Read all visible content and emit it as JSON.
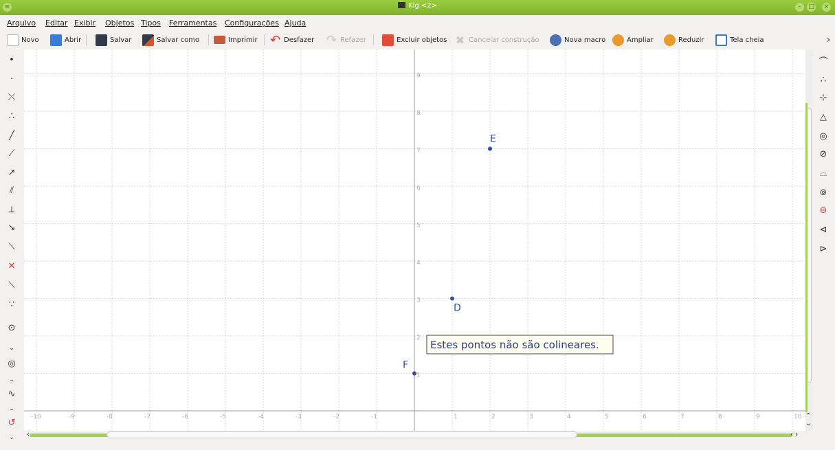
{
  "window": {
    "title": "Kig <2>"
  },
  "menu": [
    "Arquivo",
    "Editar",
    "Exibir",
    "Objetos",
    "Tipos",
    "Ferramentas",
    "Configurações",
    "Ajuda"
  ],
  "toolbar": {
    "novo": "Novo",
    "abrir": "Abrir",
    "salvar": "Salvar",
    "salvar_como": "Salvar como",
    "imprimir": "Imprimir",
    "desfazer": "Desfazer",
    "refazer": "Refazer",
    "excluir": "Excluir objetos",
    "cancelar": "Cancelar construção",
    "macro": "Nova macro",
    "ampliar": "Ampliar",
    "reduzir": "Reduzir",
    "tela_cheia": "Tela cheia",
    "more": "›"
  },
  "colors": {
    "titlebar": "#8bc034",
    "point": "#2a50a8",
    "grid": "#d6d6d6",
    "axis": "#9a9a9a",
    "tooltip_bg": "#fffff0"
  },
  "chart_data": {
    "type": "scatter",
    "xlim": [
      -10,
      10
    ],
    "ylim": [
      0,
      9
    ],
    "x_ticks": [
      "-10",
      "-9",
      "-8",
      "-7",
      "-6",
      "-5",
      "-4",
      "-3",
      "-2",
      "-1",
      "1",
      "2",
      "3",
      "4",
      "5",
      "6",
      "7",
      "8",
      "9",
      "10"
    ],
    "y_ticks": [
      "1",
      "2",
      "3",
      "4",
      "5",
      "6",
      "7",
      "8",
      "9"
    ],
    "grid": true,
    "points": [
      {
        "label": "E",
        "x": 2,
        "y": 7
      },
      {
        "label": "D",
        "x": 1,
        "y": 3
      },
      {
        "label": "F",
        "x": 0,
        "y": 1
      }
    ]
  },
  "message": "Estes pontos não são colineares."
}
